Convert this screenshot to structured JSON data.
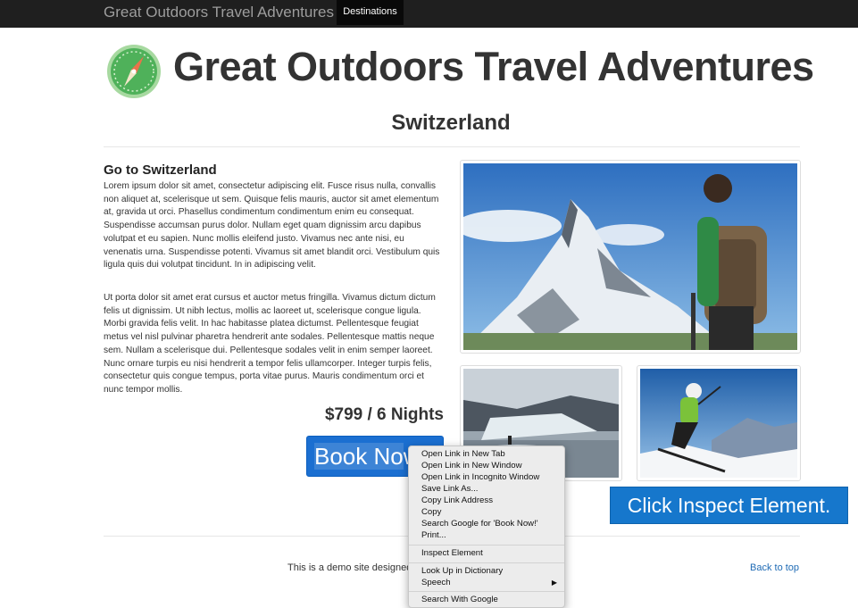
{
  "navbar": {
    "brand": "Great Outdoors Travel Adventures",
    "tab": "Destinations"
  },
  "header": {
    "title": "Great Outdoors Travel Adventures",
    "logo_icon": "compass-icon"
  },
  "page": {
    "title": "Switzerland"
  },
  "intro": {
    "heading": "Go to Switzerland",
    "paragraph1": "Lorem ipsum dolor sit amet, consectetur adipiscing elit. Fusce risus nulla, convallis non aliquet at, scelerisque ut sem. Quisque felis mauris, auctor sit amet elementum at, gravida ut orci. Phasellus condimentum condimentum enim eu consequat. Suspendisse accumsan purus dolor. Nullam eget quam dignissim arcu dapibus volutpat et eu sapien. Nunc mollis eleifend justo. Vivamus nec ante nisi, eu venenatis urna. Suspendisse potenti. Vivamus sit amet blandit orci. Vestibulum quis ligula quis dui volutpat tincidunt. In in adipiscing velit.",
    "paragraph2": "Ut porta dolor sit amet erat cursus et auctor metus fringilla. Vivamus dictum dictum felis ut dignissim. Ut nibh lectus, mollis ac laoreet ut, scelerisque congue ligula. Morbi gravida felis velit. In hac habitasse platea dictumst. Pellentesque feugiat metus vel nisl pulvinar pharetra hendrerit ante sodales. Pellentesque mattis neque sem. Nullam a scelerisque dui. Pellentesque sodales velit in enim semper laoreet. Nunc ornare turpis eu nisi hendrerit a tempor felis ullamcorper. Integer turpis felis, consectetur quis congue tempus, porta vitae purus. Mauris condimentum orci et nunc tempor mollis."
  },
  "offer": {
    "price": "$799 / 6 Nights",
    "button_selected": "Book No",
    "button_rest": "w!"
  },
  "footer": {
    "text": "This is a demo site designed",
    "back_to_top": "Back to top"
  },
  "context_menu": {
    "items": [
      "Open Link in New Tab",
      "Open Link in New Window",
      "Open Link in Incognito Window",
      "Save Link As...",
      "Copy Link Address",
      "Copy",
      "Search Google for 'Book Now!'",
      "Print...",
      "Inspect Element",
      "Look Up in Dictionary",
      "Speech",
      "Search With Google"
    ]
  },
  "callout": {
    "text": "Click Inspect Element."
  }
}
